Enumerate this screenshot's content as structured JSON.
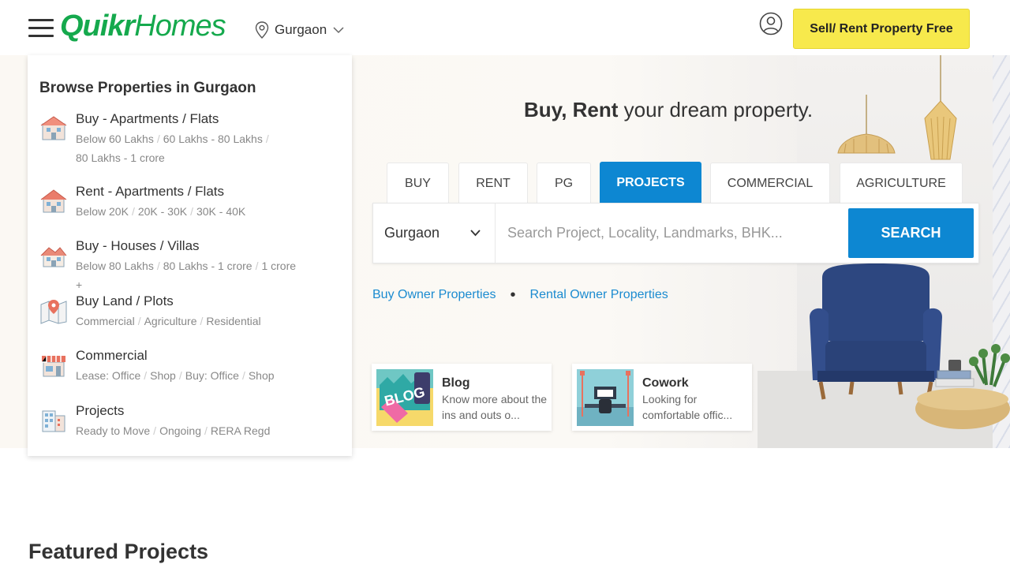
{
  "header": {
    "logo_quikr": "Quikr",
    "logo_homes": "Homes",
    "city": "Gurgaon",
    "sell_button": "Sell/ Rent Property Free"
  },
  "browse": {
    "title": "Browse Properties in Gurgaon",
    "categories": [
      {
        "title": "Buy - Apartments / Flats",
        "links": [
          "Below 60 Lakhs",
          "60 Lakhs - 80 Lakhs",
          "80 Lakhs - 1 crore"
        ],
        "icon": "apartment-icon"
      },
      {
        "title": "Rent - Apartments / Flats",
        "links": [
          "Below 20K",
          "20K - 30K",
          "30K - 40K"
        ],
        "icon": "rent-house-icon"
      },
      {
        "title": "Buy - Houses / Villas",
        "links": [
          "Below 80 Lakhs",
          "80 Lakhs - 1 crore",
          "1 crore +"
        ],
        "icon": "villa-icon"
      },
      {
        "title": "Buy Land / Plots",
        "links": [
          "Commercial",
          "Agriculture",
          "Residential"
        ],
        "icon": "map-pin-icon"
      },
      {
        "title": "Commercial",
        "links": [
          "Lease: Office",
          "Shop",
          "Buy: Office",
          "Shop"
        ],
        "icon": "shop-icon"
      },
      {
        "title": "Projects",
        "links": [
          "Ready to Move",
          "Ongoing",
          "RERA Regd"
        ],
        "icon": "building-icon"
      }
    ]
  },
  "hero": {
    "title_bold": "Buy, Rent",
    "title_rest": " your dream property.",
    "tabs": [
      "BUY",
      "RENT",
      "PG",
      "PROJECTS",
      "COMMERCIAL",
      "AGRICULTURE"
    ],
    "active_tab": "PROJECTS",
    "search_city": "Gurgaon",
    "search_placeholder": "Search Project, Locality, Landmarks, BHK...",
    "search_button": "SEARCH",
    "owner_links": [
      "Buy Owner Properties",
      "Rental Owner Properties"
    ]
  },
  "cards": [
    {
      "title": "Blog",
      "desc": "Know more about the ins and outs o..."
    },
    {
      "title": "Cowork",
      "desc": "Looking for comfortable offic..."
    }
  ],
  "featured": {
    "title": "Featured Projects"
  },
  "colors": {
    "brand_green": "#15a94d",
    "accent_blue": "#0d87d2",
    "sell_yellow": "#f7e94c"
  }
}
